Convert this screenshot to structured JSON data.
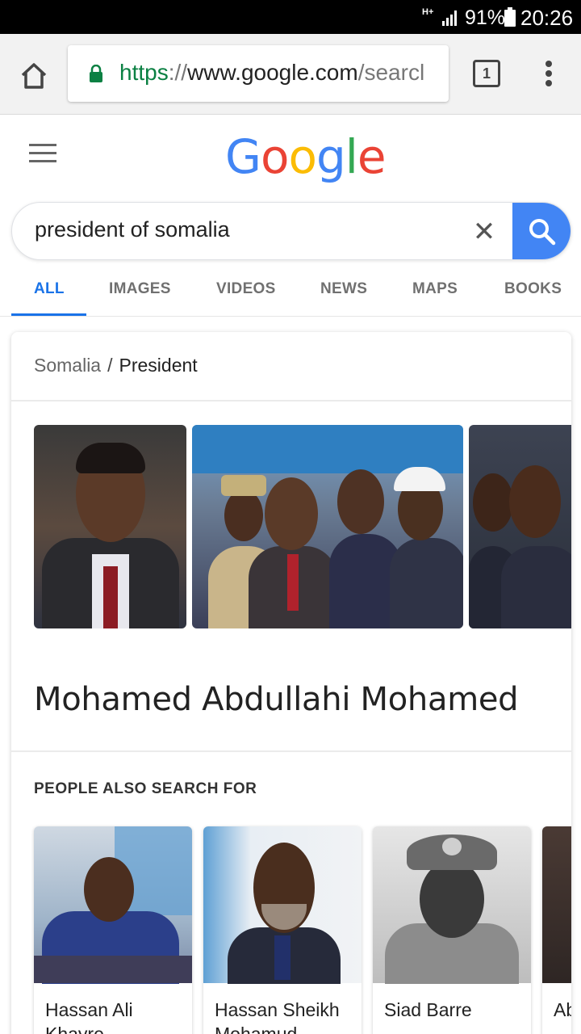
{
  "status_bar": {
    "network": "H+",
    "battery_percent": "91%",
    "time": "20:26"
  },
  "browser": {
    "url_scheme": "https",
    "url_separator": "://",
    "url_host": "www.google.com",
    "url_path": "/searcl",
    "tab_count": "1"
  },
  "search": {
    "query": "president of somalia"
  },
  "nav_tabs": [
    "ALL",
    "IMAGES",
    "VIDEOS",
    "NEWS",
    "MAPS",
    "BOOKS"
  ],
  "knowledge_panel": {
    "breadcrumb_parent": "Somalia",
    "breadcrumb_separator": "/",
    "breadcrumb_current": "President",
    "entity_name": "Mohamed Abdullahi Mohamed",
    "people_also_search_title": "PEOPLE ALSO SEARCH FOR",
    "people": [
      {
        "name": "Hassan Ali Khayre"
      },
      {
        "name": "Hassan Sheikh Mohamud"
      },
      {
        "name": "Siad Barre"
      },
      {
        "name": "Abdi Ma"
      }
    ]
  },
  "colors": {
    "accent": "#1a73e8",
    "search_button": "#4285f4",
    "https_green": "#0b8043"
  }
}
